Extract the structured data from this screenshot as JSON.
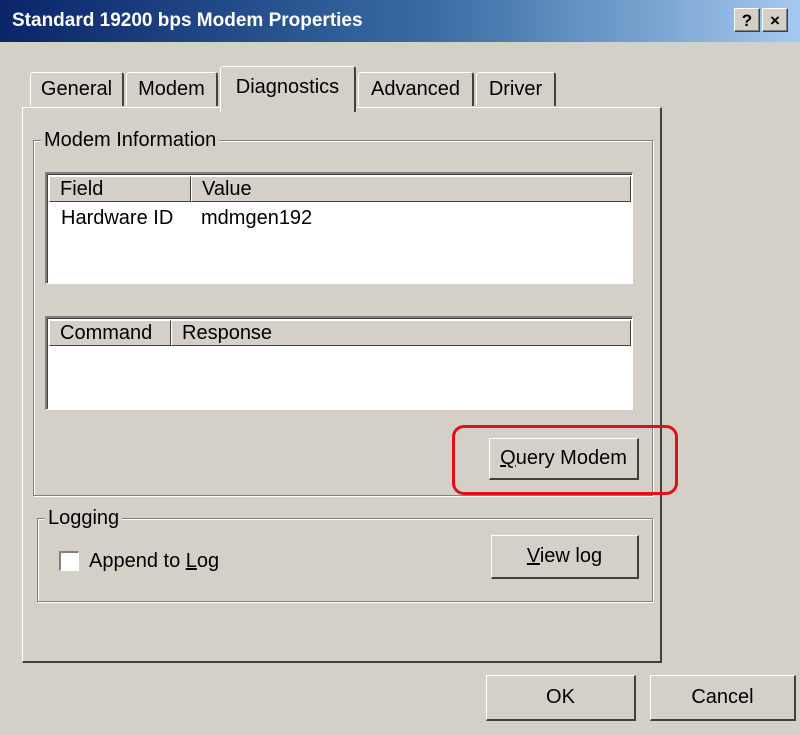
{
  "window": {
    "title": "Standard 19200 bps Modem Properties",
    "help_label": "?",
    "close_label": "×"
  },
  "tabs": [
    {
      "label": "General",
      "active": false
    },
    {
      "label": "Modem",
      "active": false
    },
    {
      "label": "Diagnostics",
      "active": true
    },
    {
      "label": "Advanced",
      "active": false
    },
    {
      "label": "Driver",
      "active": false
    }
  ],
  "modem_info": {
    "group_label": "Modem Information",
    "info_table": {
      "columns": [
        "Field",
        "Value"
      ],
      "rows": [
        [
          "Hardware ID",
          "mdmgen192"
        ]
      ]
    },
    "command_table": {
      "columns": [
        "Command",
        "Response"
      ],
      "rows": []
    },
    "query_button": {
      "mnemonic": "Q",
      "rest": "uery Modem"
    }
  },
  "logging": {
    "group_label": "Logging",
    "append_checkbox": {
      "pre": "Append to ",
      "mnemonic": "L",
      "post": "og",
      "checked": false
    },
    "view_log_button": {
      "mnemonic": "V",
      "rest": "iew log"
    }
  },
  "footer": {
    "ok_label": "OK",
    "cancel_label": "Cancel"
  },
  "colors": {
    "highlight": "#e0101a",
    "titlebar_start": "#0a246a",
    "face": "#d4d0c8"
  }
}
